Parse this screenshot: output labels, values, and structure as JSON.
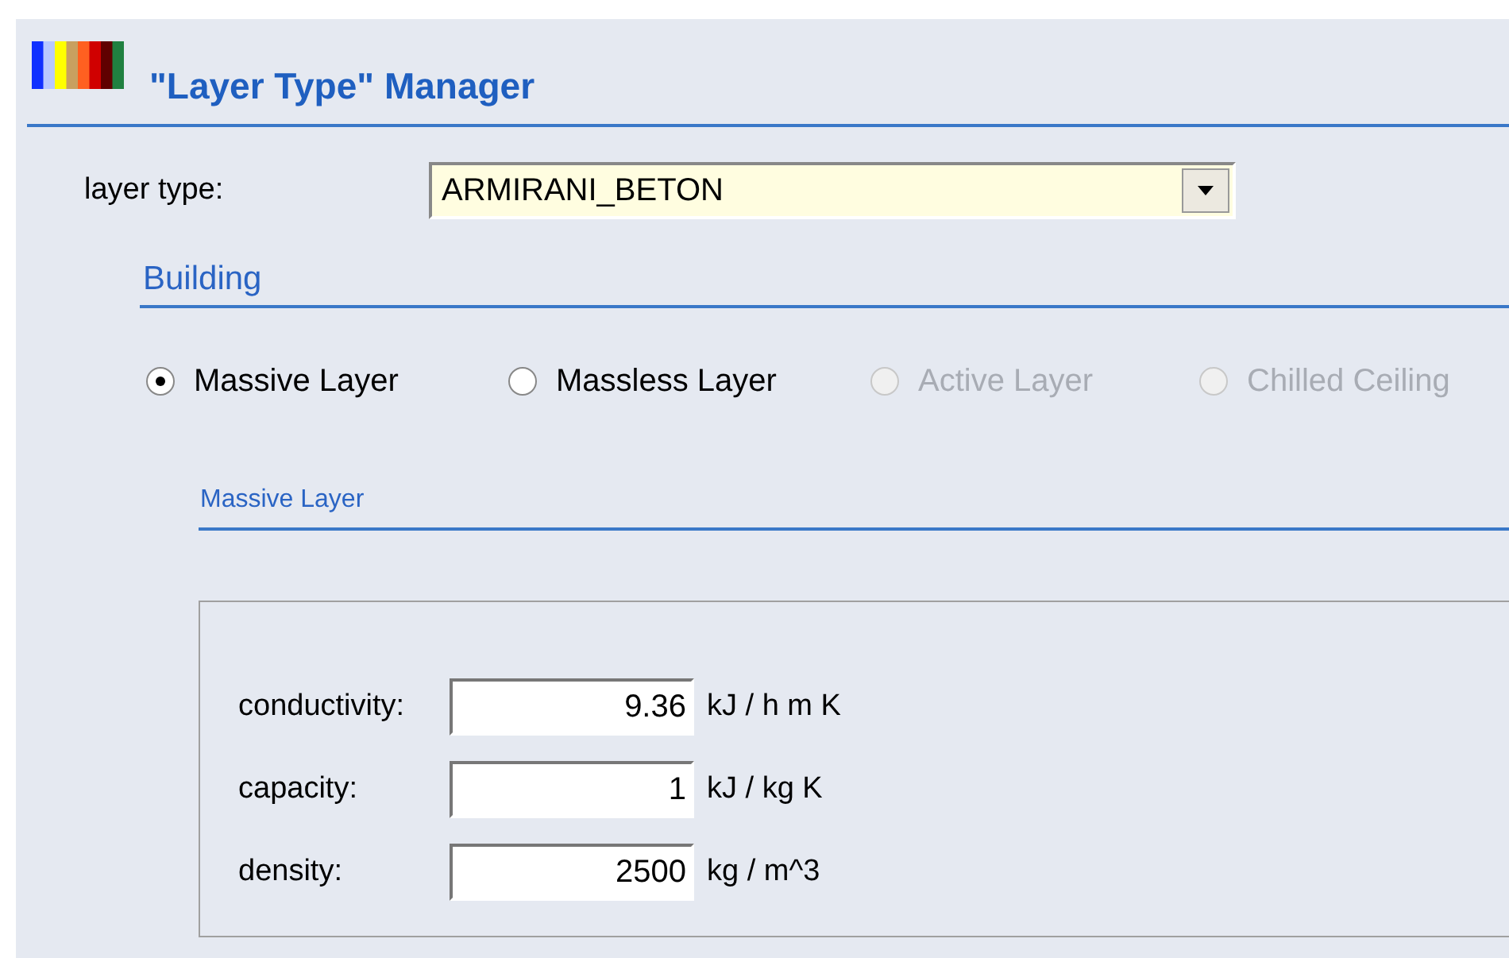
{
  "header": {
    "title": "\"Layer Type\" Manager"
  },
  "layer_type": {
    "label": "layer type:",
    "value": "ARMIRANI_BETON"
  },
  "building": {
    "heading": "Building"
  },
  "layer_options": [
    {
      "label": "Massive Layer",
      "selected": true,
      "disabled": false
    },
    {
      "label": "Massless Layer",
      "selected": false,
      "disabled": false
    },
    {
      "label": "Active Layer",
      "selected": false,
      "disabled": true
    },
    {
      "label": "Chilled Ceiling",
      "selected": false,
      "disabled": true
    }
  ],
  "massive_layer": {
    "heading": "Massive Layer",
    "fields": [
      {
        "label": "conductivity:",
        "value": "9.36",
        "unit": "kJ / h m K"
      },
      {
        "label": "capacity:",
        "value": "1",
        "unit": "kJ / kg K"
      },
      {
        "label": "density:",
        "value": "2500",
        "unit": "kg / m^3"
      }
    ]
  }
}
